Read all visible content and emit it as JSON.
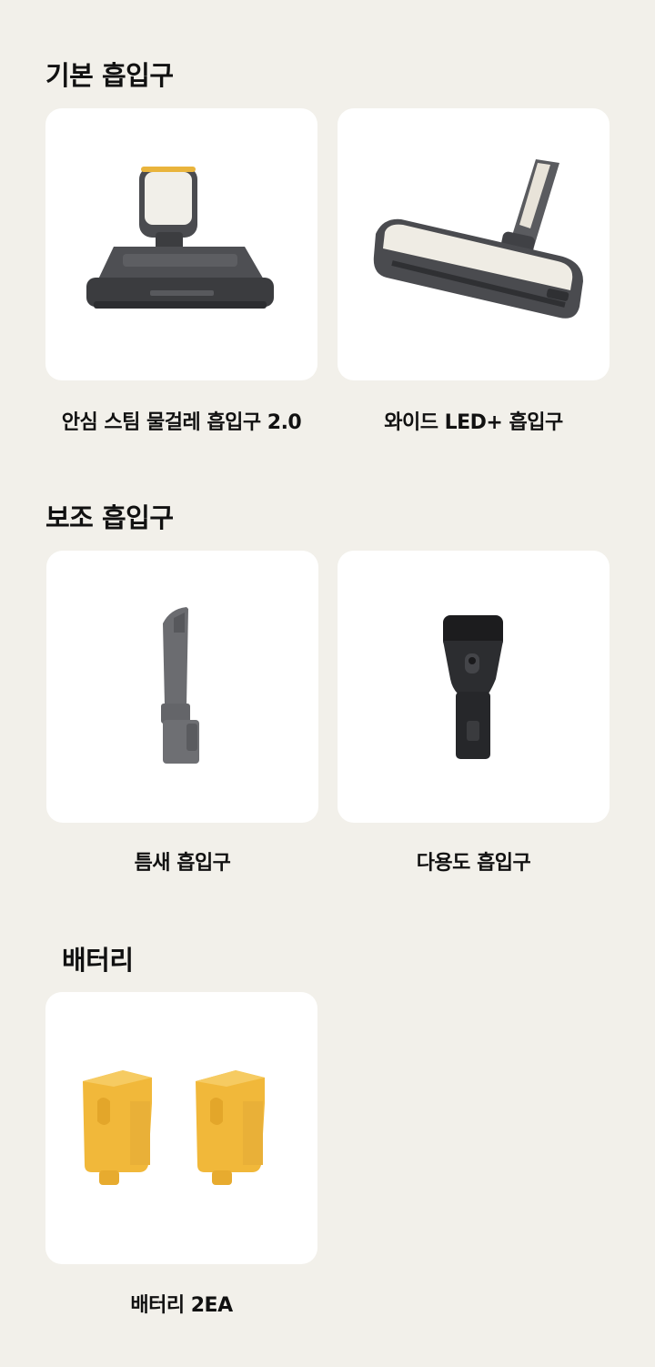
{
  "sections": [
    {
      "title": "기본 흡입구",
      "items": [
        {
          "label": "안심 스팀 물걸레 흡입구 2.0",
          "icon": "steam-mop-nozzle-image"
        },
        {
          "label": "와이드 LED+ 흡입구",
          "icon": "wide-led-nozzle-image"
        }
      ]
    },
    {
      "title": "보조 흡입구",
      "items": [
        {
          "label": "틈새 흡입구",
          "icon": "crevice-nozzle-image"
        },
        {
          "label": "다용도 흡입구",
          "icon": "multi-purpose-nozzle-image"
        }
      ]
    },
    {
      "title": "배터리",
      "items": [
        {
          "label": "배터리 2EA",
          "icon": "battery-pack-image"
        }
      ]
    }
  ],
  "colors": {
    "background": "#f2f0ea",
    "card": "#ffffff",
    "battery_yellow": "#f1b83a",
    "accent_yellow": "#e9b43c"
  }
}
